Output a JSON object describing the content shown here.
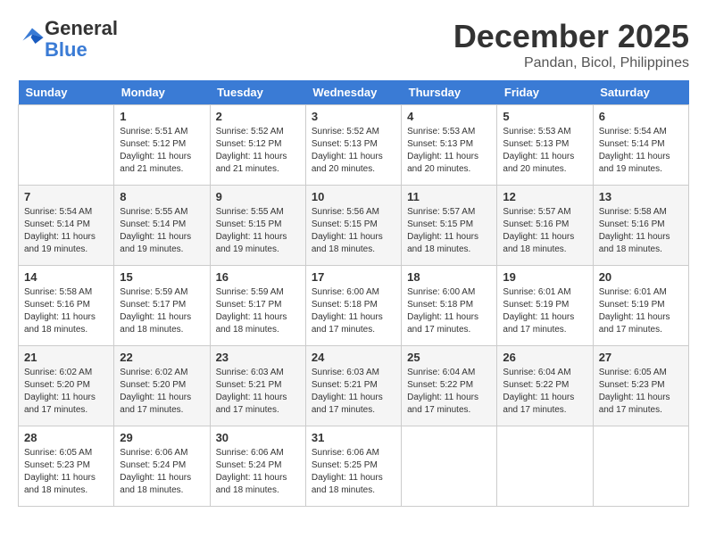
{
  "logo": {
    "general": "General",
    "blue": "Blue"
  },
  "title": "December 2025",
  "location": "Pandan, Bicol, Philippines",
  "days_of_week": [
    "Sunday",
    "Monday",
    "Tuesday",
    "Wednesday",
    "Thursday",
    "Friday",
    "Saturday"
  ],
  "weeks": [
    [
      {
        "day": "",
        "sunrise": "",
        "sunset": "",
        "daylight": ""
      },
      {
        "day": "1",
        "sunrise": "Sunrise: 5:51 AM",
        "sunset": "Sunset: 5:12 PM",
        "daylight": "Daylight: 11 hours and 21 minutes."
      },
      {
        "day": "2",
        "sunrise": "Sunrise: 5:52 AM",
        "sunset": "Sunset: 5:12 PM",
        "daylight": "Daylight: 11 hours and 21 minutes."
      },
      {
        "day": "3",
        "sunrise": "Sunrise: 5:52 AM",
        "sunset": "Sunset: 5:13 PM",
        "daylight": "Daylight: 11 hours and 20 minutes."
      },
      {
        "day": "4",
        "sunrise": "Sunrise: 5:53 AM",
        "sunset": "Sunset: 5:13 PM",
        "daylight": "Daylight: 11 hours and 20 minutes."
      },
      {
        "day": "5",
        "sunrise": "Sunrise: 5:53 AM",
        "sunset": "Sunset: 5:13 PM",
        "daylight": "Daylight: 11 hours and 20 minutes."
      },
      {
        "day": "6",
        "sunrise": "Sunrise: 5:54 AM",
        "sunset": "Sunset: 5:14 PM",
        "daylight": "Daylight: 11 hours and 19 minutes."
      }
    ],
    [
      {
        "day": "7",
        "sunrise": "Sunrise: 5:54 AM",
        "sunset": "Sunset: 5:14 PM",
        "daylight": "Daylight: 11 hours and 19 minutes."
      },
      {
        "day": "8",
        "sunrise": "Sunrise: 5:55 AM",
        "sunset": "Sunset: 5:14 PM",
        "daylight": "Daylight: 11 hours and 19 minutes."
      },
      {
        "day": "9",
        "sunrise": "Sunrise: 5:55 AM",
        "sunset": "Sunset: 5:15 PM",
        "daylight": "Daylight: 11 hours and 19 minutes."
      },
      {
        "day": "10",
        "sunrise": "Sunrise: 5:56 AM",
        "sunset": "Sunset: 5:15 PM",
        "daylight": "Daylight: 11 hours and 18 minutes."
      },
      {
        "day": "11",
        "sunrise": "Sunrise: 5:57 AM",
        "sunset": "Sunset: 5:15 PM",
        "daylight": "Daylight: 11 hours and 18 minutes."
      },
      {
        "day": "12",
        "sunrise": "Sunrise: 5:57 AM",
        "sunset": "Sunset: 5:16 PM",
        "daylight": "Daylight: 11 hours and 18 minutes."
      },
      {
        "day": "13",
        "sunrise": "Sunrise: 5:58 AM",
        "sunset": "Sunset: 5:16 PM",
        "daylight": "Daylight: 11 hours and 18 minutes."
      }
    ],
    [
      {
        "day": "14",
        "sunrise": "Sunrise: 5:58 AM",
        "sunset": "Sunset: 5:16 PM",
        "daylight": "Daylight: 11 hours and 18 minutes."
      },
      {
        "day": "15",
        "sunrise": "Sunrise: 5:59 AM",
        "sunset": "Sunset: 5:17 PM",
        "daylight": "Daylight: 11 hours and 18 minutes."
      },
      {
        "day": "16",
        "sunrise": "Sunrise: 5:59 AM",
        "sunset": "Sunset: 5:17 PM",
        "daylight": "Daylight: 11 hours and 18 minutes."
      },
      {
        "day": "17",
        "sunrise": "Sunrise: 6:00 AM",
        "sunset": "Sunset: 5:18 PM",
        "daylight": "Daylight: 11 hours and 17 minutes."
      },
      {
        "day": "18",
        "sunrise": "Sunrise: 6:00 AM",
        "sunset": "Sunset: 5:18 PM",
        "daylight": "Daylight: 11 hours and 17 minutes."
      },
      {
        "day": "19",
        "sunrise": "Sunrise: 6:01 AM",
        "sunset": "Sunset: 5:19 PM",
        "daylight": "Daylight: 11 hours and 17 minutes."
      },
      {
        "day": "20",
        "sunrise": "Sunrise: 6:01 AM",
        "sunset": "Sunset: 5:19 PM",
        "daylight": "Daylight: 11 hours and 17 minutes."
      }
    ],
    [
      {
        "day": "21",
        "sunrise": "Sunrise: 6:02 AM",
        "sunset": "Sunset: 5:20 PM",
        "daylight": "Daylight: 11 hours and 17 minutes."
      },
      {
        "day": "22",
        "sunrise": "Sunrise: 6:02 AM",
        "sunset": "Sunset: 5:20 PM",
        "daylight": "Daylight: 11 hours and 17 minutes."
      },
      {
        "day": "23",
        "sunrise": "Sunrise: 6:03 AM",
        "sunset": "Sunset: 5:21 PM",
        "daylight": "Daylight: 11 hours and 17 minutes."
      },
      {
        "day": "24",
        "sunrise": "Sunrise: 6:03 AM",
        "sunset": "Sunset: 5:21 PM",
        "daylight": "Daylight: 11 hours and 17 minutes."
      },
      {
        "day": "25",
        "sunrise": "Sunrise: 6:04 AM",
        "sunset": "Sunset: 5:22 PM",
        "daylight": "Daylight: 11 hours and 17 minutes."
      },
      {
        "day": "26",
        "sunrise": "Sunrise: 6:04 AM",
        "sunset": "Sunset: 5:22 PM",
        "daylight": "Daylight: 11 hours and 17 minutes."
      },
      {
        "day": "27",
        "sunrise": "Sunrise: 6:05 AM",
        "sunset": "Sunset: 5:23 PM",
        "daylight": "Daylight: 11 hours and 17 minutes."
      }
    ],
    [
      {
        "day": "28",
        "sunrise": "Sunrise: 6:05 AM",
        "sunset": "Sunset: 5:23 PM",
        "daylight": "Daylight: 11 hours and 18 minutes."
      },
      {
        "day": "29",
        "sunrise": "Sunrise: 6:06 AM",
        "sunset": "Sunset: 5:24 PM",
        "daylight": "Daylight: 11 hours and 18 minutes."
      },
      {
        "day": "30",
        "sunrise": "Sunrise: 6:06 AM",
        "sunset": "Sunset: 5:24 PM",
        "daylight": "Daylight: 11 hours and 18 minutes."
      },
      {
        "day": "31",
        "sunrise": "Sunrise: 6:06 AM",
        "sunset": "Sunset: 5:25 PM",
        "daylight": "Daylight: 11 hours and 18 minutes."
      },
      {
        "day": "",
        "sunrise": "",
        "sunset": "",
        "daylight": ""
      },
      {
        "day": "",
        "sunrise": "",
        "sunset": "",
        "daylight": ""
      },
      {
        "day": "",
        "sunrise": "",
        "sunset": "",
        "daylight": ""
      }
    ]
  ]
}
